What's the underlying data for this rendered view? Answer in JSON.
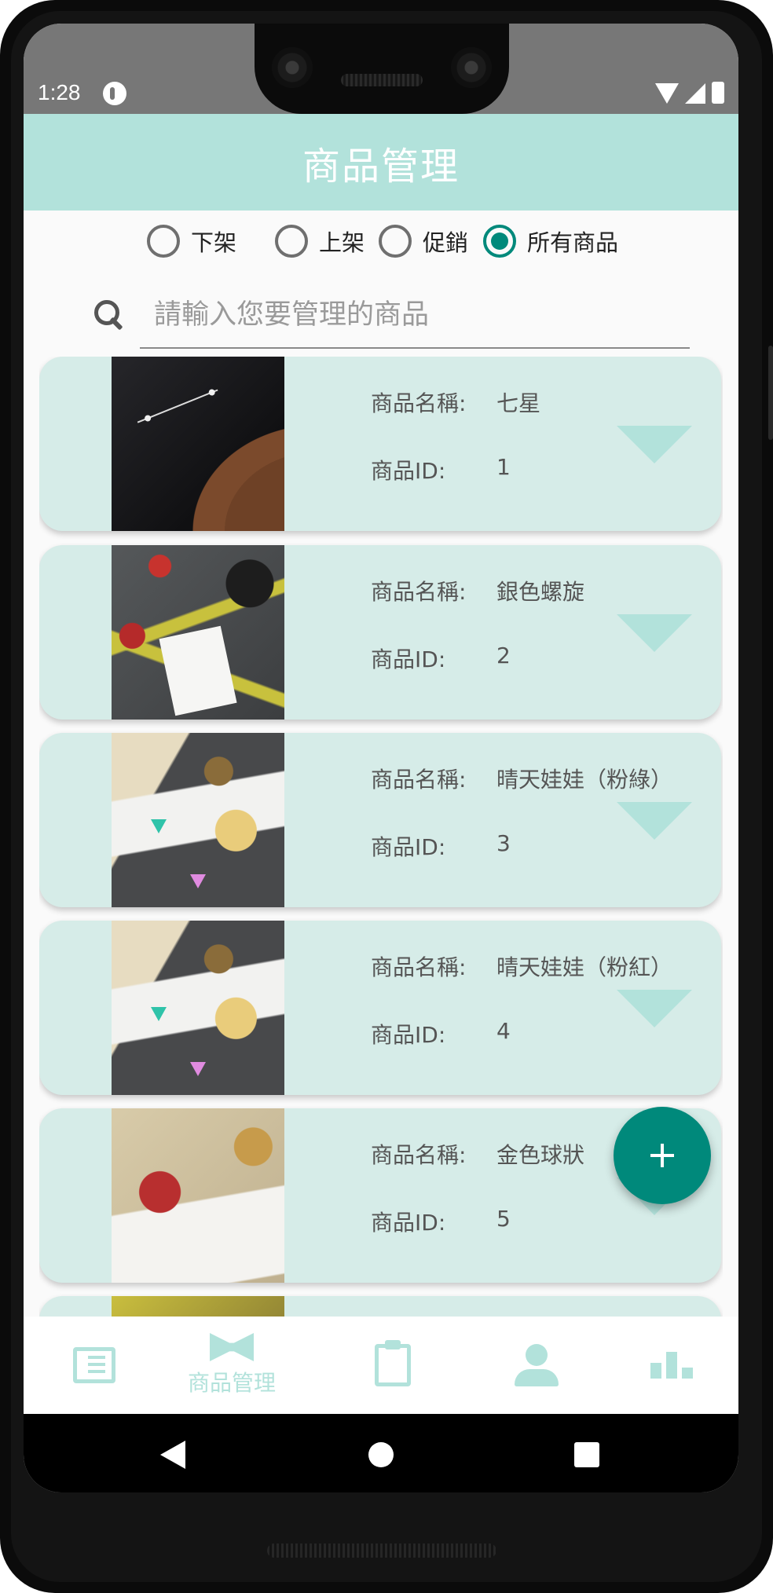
{
  "status_bar": {
    "time": "1:28"
  },
  "app_bar": {
    "title": "商品管理"
  },
  "filters": [
    {
      "label": "下架",
      "selected": false
    },
    {
      "label": "上架",
      "selected": false
    },
    {
      "label": "促銷",
      "selected": false
    },
    {
      "label": "所有商品",
      "selected": true
    }
  ],
  "search": {
    "placeholder": "請輸入您要管理的商品",
    "value": ""
  },
  "product_labels": {
    "name": "商品名稱:",
    "id": "商品ID:"
  },
  "products": [
    {
      "name": "七星",
      "id": "1"
    },
    {
      "name": "銀色螺旋",
      "id": "2"
    },
    {
      "name": "晴天娃娃（粉綠）",
      "id": "3"
    },
    {
      "name": "晴天娃娃（粉紅）",
      "id": "4"
    },
    {
      "name": "金色球狀",
      "id": "5"
    }
  ],
  "fab": {
    "icon": "plus-icon"
  },
  "bottom_nav": {
    "items": [
      {
        "icon": "news-icon",
        "label": ""
      },
      {
        "icon": "bowtie-icon",
        "label": "商品管理"
      },
      {
        "icon": "clipboard-icon",
        "label": ""
      },
      {
        "icon": "person-icon",
        "label": ""
      },
      {
        "icon": "bar-chart-icon",
        "label": ""
      }
    ],
    "active_color": "#b2e2db"
  },
  "colors": {
    "accent": "#00897b",
    "app_bar": "#b2e2db",
    "card": "#d6ece8"
  }
}
